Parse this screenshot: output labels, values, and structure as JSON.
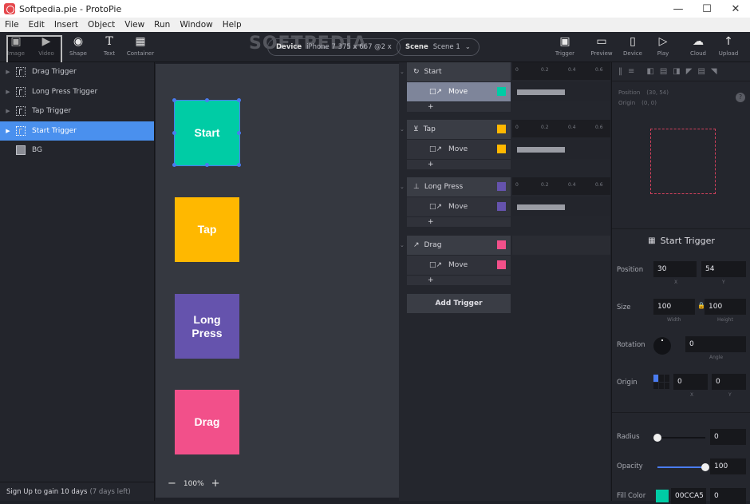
{
  "window": {
    "title": "Softpedia.pie - ProtoPie",
    "controls": {
      "minimize": "—",
      "maximize": "☐",
      "close": "✕"
    }
  },
  "menu": [
    "File",
    "Edit",
    "Insert",
    "Object",
    "View",
    "Run",
    "Window",
    "Help"
  ],
  "toolbar": {
    "left_tools": [
      {
        "label": "Image",
        "icon": "image-icon"
      },
      {
        "label": "Video",
        "icon": "video-icon"
      },
      {
        "label": "Shape",
        "icon": "shape-icon"
      },
      {
        "label": "Text",
        "icon": "text-icon"
      },
      {
        "label": "Container",
        "icon": "container-icon"
      }
    ],
    "device": {
      "key": "Device",
      "value": "iPhone 7  375 x 667  @2 x"
    },
    "scene": {
      "key": "Scene",
      "value": "Scene 1"
    },
    "right_tools": [
      {
        "label": "Trigger",
        "icon": "trigger-icon"
      },
      {
        "label": "Preview",
        "icon": "preview-icon"
      },
      {
        "label": "Device",
        "icon": "device-icon"
      },
      {
        "label": "Play",
        "icon": "play-icon"
      },
      {
        "label": "Cloud",
        "icon": "cloud-icon"
      },
      {
        "label": "Upload",
        "icon": "upload-icon"
      }
    ],
    "watermark": "SOFTPEDIA"
  },
  "layers": [
    {
      "label": "Drag Trigger",
      "selected": false
    },
    {
      "label": "Long Press Trigger",
      "selected": false
    },
    {
      "label": "Tap Trigger",
      "selected": false
    },
    {
      "label": "Start Trigger",
      "selected": true
    },
    {
      "label": "BG",
      "selected": false
    }
  ],
  "signup": {
    "text": "Sign Up to gain 10 days",
    "muted": "(7 days left)"
  },
  "canvas": {
    "shapes": [
      {
        "label": "Start",
        "color": "#00CCA5"
      },
      {
        "label": "Tap",
        "color": "#FFB800"
      },
      {
        "label": "Long Press",
        "color": "#6553AD"
      },
      {
        "label": "Drag",
        "color": "#F2508A"
      }
    ],
    "zoom": {
      "minus": "−",
      "value": "100%",
      "plus": "+"
    }
  },
  "interactions": [
    {
      "trigger": "Start",
      "response": "Move",
      "color": "#00CCA5",
      "duration_s": 0.4
    },
    {
      "trigger": "Tap",
      "response": "Move",
      "color": "#FFB800",
      "duration_s": 0.4
    },
    {
      "trigger": "Long Press",
      "response": "Move",
      "color": "#6553AD",
      "duration_s": 0.4
    },
    {
      "trigger": "Drag",
      "response": "Move",
      "color": "#F2508A"
    }
  ],
  "ruler_ticks": [
    "0",
    "0.2",
    "0.4",
    "0.6"
  ],
  "add_response": "+",
  "add_trigger": "Add Trigger",
  "properties": {
    "mini_info": {
      "position_label": "Position",
      "position_value": "(30, 54)",
      "origin_label": "Origin",
      "origin_value": "(0, 0)"
    },
    "help": "?",
    "selection_name": "Start Trigger",
    "position": {
      "label": "Position",
      "x": "30",
      "y": "54",
      "x_sub": "X",
      "y_sub": "Y"
    },
    "size": {
      "label": "Size",
      "width": "100",
      "height": "100",
      "w_sub": "Width",
      "h_sub": "Height"
    },
    "rotation": {
      "label": "Rotation",
      "angle": "0",
      "sub": "Angle"
    },
    "origin": {
      "label": "Origin",
      "x": "0",
      "y": "0",
      "x_sub": "X",
      "y_sub": "Y"
    },
    "radius": {
      "label": "Radius",
      "value": "0",
      "fraction": 0.0
    },
    "opacity": {
      "label": "Opacity",
      "value": "100",
      "fraction": 1.0
    },
    "fill": {
      "label": "Fill Color",
      "hex": "00CCA5",
      "color": "#00CCA5",
      "extra": "0"
    }
  }
}
